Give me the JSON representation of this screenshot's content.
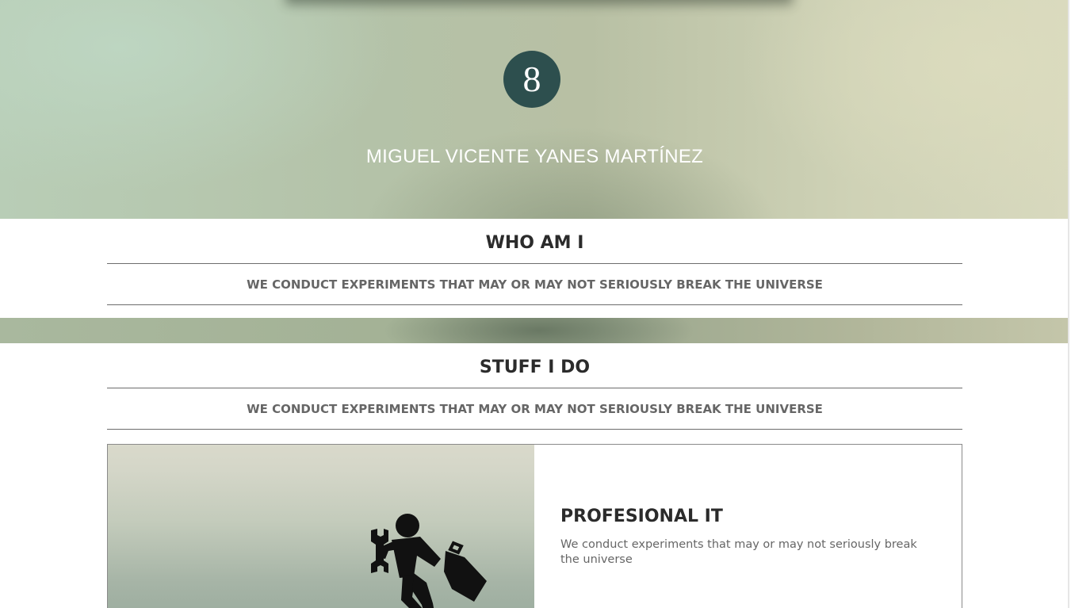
{
  "hero": {
    "badge_number": "8",
    "name": "MIGUEL VICENTE YANES MARTÍNEZ"
  },
  "who_am_i": {
    "title": "WHO AM I",
    "subtitle": "WE CONDUCT EXPERIMENTS THAT MAY OR MAY NOT SERIOUSLY BREAK THE UNIVERSE"
  },
  "stuff_i_do": {
    "title": "STUFF I DO",
    "subtitle": "WE CONDUCT EXPERIMENTS THAT MAY OR MAY NOT SERIOUSLY BREAK THE UNIVERSE",
    "cards": [
      {
        "icon": "worker-running-with-wrench-and-toolbox-icon",
        "title": "PROFESIONAL IT",
        "text": "We conduct experiments that may or may not seriously break the universe"
      }
    ]
  },
  "colors": {
    "badge_bg": "#2d4f4e",
    "title_text": "#2b2b2b",
    "subtitle_text": "#666666",
    "divider": "#6d6d6d"
  }
}
